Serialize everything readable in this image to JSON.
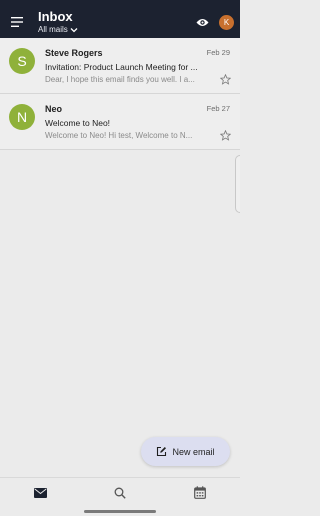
{
  "appbar": {
    "title": "Inbox",
    "filter_label": "All mails",
    "avatar_letter": "K",
    "avatar_color": "#c8702e",
    "background_color": "#1c2230"
  },
  "emails": [
    {
      "avatar_letter": "S",
      "sender": "Steve Rogers",
      "date": "Feb 29",
      "subject": "Invitation: Product Launch Meeting for ...",
      "preview": "Dear, I hope this email finds you well. I a..."
    },
    {
      "avatar_letter": "N",
      "sender": "Neo",
      "date": "Feb 27",
      "subject": "Welcome to Neo!",
      "preview": "Welcome to Neo! Hi test, Welcome to N..."
    }
  ],
  "fab": {
    "label": "New email"
  },
  "bottom_nav": {
    "items": [
      "mail-icon",
      "search-icon",
      "calendar-icon"
    ],
    "active": "mail-icon"
  }
}
